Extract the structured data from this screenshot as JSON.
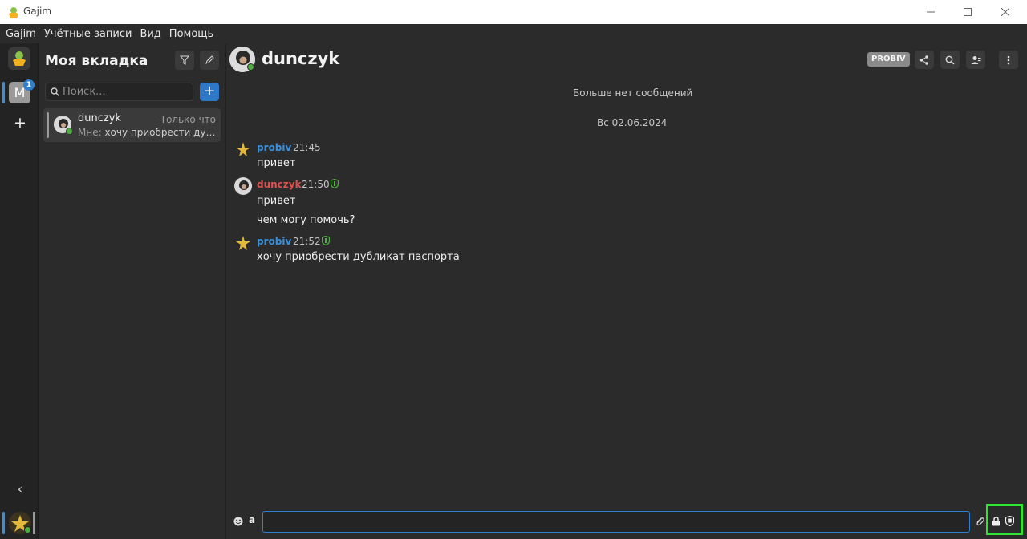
{
  "window": {
    "title": "Gajim"
  },
  "menu": [
    "Gajim",
    "Учётные записи",
    "Вид",
    "Помощь"
  ],
  "rail": {
    "account_letter": "M",
    "badge_count": "1"
  },
  "chatlist": {
    "heading": "Моя вкладка",
    "search_placeholder": "Поиск...",
    "rows": [
      {
        "name": "dunczyk",
        "time": "Только что",
        "preview_prefix": "Мне:",
        "preview": "хочу приобрести дубли…"
      }
    ]
  },
  "chat": {
    "contact_name": "dunczyk",
    "account_badge": "PROBIV",
    "no_more_messages": "Больше нет сообщений",
    "date_separator": "Вс 02.06.2024",
    "messages": [
      {
        "author": "probiv",
        "time": "21:45",
        "lines": [
          "привет"
        ],
        "author_color": "#3a8fd8",
        "encrypted": false
      },
      {
        "author": "dunczyk",
        "time": "21:50",
        "lines": [
          "привет",
          "чем могу помочь?"
        ],
        "author_color": "#d9534f",
        "encrypted": true
      },
      {
        "author": "probiv",
        "time": "21:52",
        "lines": [
          "хочу приобрести дубликат паспорта"
        ],
        "author_color": "#3a8fd8",
        "encrypted": true
      }
    ],
    "input_value": ""
  },
  "colors": {
    "accent": "#2f7fd1",
    "online": "#4cae3c",
    "shield_green": "#4cae3c",
    "highlight_box": "#2ee52e"
  }
}
